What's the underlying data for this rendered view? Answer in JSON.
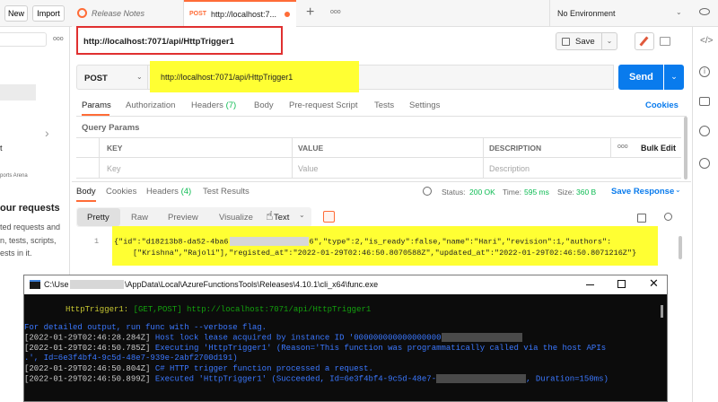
{
  "top": {
    "new_label": "New",
    "import_label": "Import",
    "tab1_label": "Release Notes",
    "tab2_method": "POST",
    "tab2_label": "http://localhost:7...",
    "add_tab_glyph": "+",
    "more_glyph": "ooo",
    "environment": "No Environment"
  },
  "left": {
    "snip_1": "t",
    "snip_2": "ports Arena",
    "heading": "our requests",
    "line1": "ted requests and",
    "line2": "n, tests, scripts,",
    "line3": "ests in it."
  },
  "request": {
    "title": "http://localhost:7071/api/HttpTrigger1",
    "save_label": "Save",
    "method": "POST",
    "url": "http://localhost:7071/api/HttpTrigger1",
    "send_label": "Send",
    "tabs": [
      {
        "label": "Params"
      },
      {
        "label": "Authorization"
      },
      {
        "label": "Headers",
        "count": "(7)"
      },
      {
        "label": "Body"
      },
      {
        "label": "Pre-request Script"
      },
      {
        "label": "Tests"
      },
      {
        "label": "Settings"
      }
    ],
    "cookies": "Cookies",
    "query_params": "Query Params",
    "columns": {
      "key": "KEY",
      "value": "VALUE",
      "description": "DESCRIPTION",
      "bulk_edit": "Bulk Edit"
    },
    "placeholders": {
      "key": "Key",
      "value": "Value",
      "description": "Description"
    }
  },
  "response": {
    "tabs": [
      {
        "label": "Body"
      },
      {
        "label": "Cookies"
      },
      {
        "label": "Headers",
        "count": "(4)"
      },
      {
        "label": "Test Results"
      }
    ],
    "status_label": "Status:",
    "status": "200 OK",
    "time_label": "Time:",
    "time": "595 ms",
    "size_label": "Size:",
    "size": "360 B",
    "save_response": "Save Response",
    "view_tabs": [
      "Pretty",
      "Raw",
      "Preview",
      "Visualize"
    ],
    "format": "Text",
    "line_number": "1",
    "body_line1_a": "{\"id\":\"d18213b8-da52-4ba6",
    "body_line1_b": "6\",\"type\":2,\"is_ready\":false,\"name\":\"Hari\",\"revision\":1,\"authors\":",
    "body_line2": "[\"Krishna\",\"Rajoli\"],\"registed_at\":\"2022-01-29T02:46:50.8070588Z\",\"updated_at\":\"2022-01-29T02:46:50.8071216Z\"}"
  },
  "console": {
    "title": "C:\\Use",
    "title_rest": "\\AppData\\Local\\AzureFunctionsTools\\Releases\\4.10.1\\cli_x64\\func.exe",
    "func_name": "HttpTrigger1:",
    "func_route": "[GET,POST] http://localhost:7071/api/HttpTrigger1",
    "line_verbose": "For detailed output, run func with --verbose flag.",
    "log1_ts": "[2022-01-29T02:46:28.284Z]",
    "log1_msg": "Host lock lease acquired by instance ID '000000000000000000",
    "log2_ts": "[2022-01-29T02:46:50.785Z]",
    "log2_msg": "Executing 'HttpTrigger1' (Reason='This function was programmatically called via the host APIs",
    "log2b": ".', Id=6e3f4bf4-9c5d-48e7-939e-2abf2700d191)",
    "log3_ts": "[2022-01-29T02:46:50.804Z]",
    "log3_msg": "C# HTTP trigger function processed a request.",
    "log4_ts": "[2022-01-29T02:46:50.899Z]",
    "log4_msg_a": "Executed 'HttpTrigger1' (Succeeded, Id=6e3f4bf4-9c5d-48e7-",
    "log4_msg_b": ", Duration=150ms)"
  }
}
